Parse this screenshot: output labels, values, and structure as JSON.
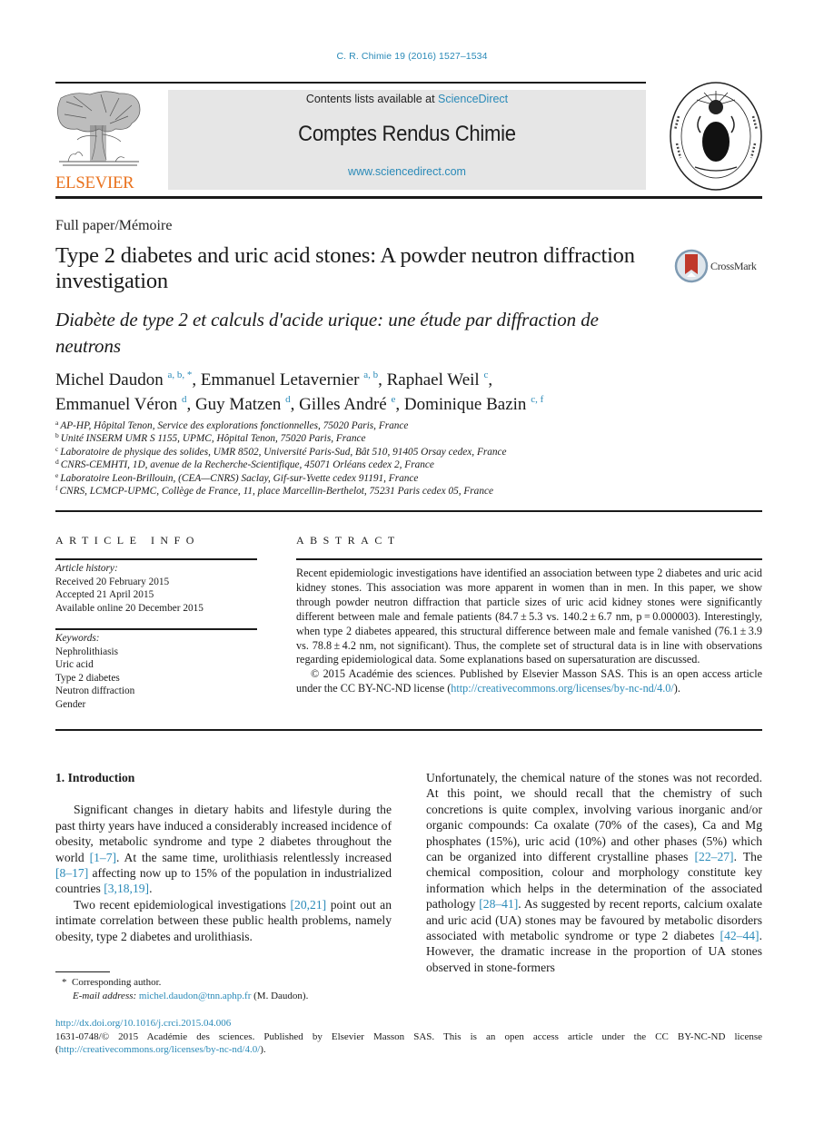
{
  "journal_ref": "C. R. Chimie 19 (2016) 1527–1534",
  "masthead": {
    "contents_prefix": "Contents lists available at ",
    "contents_link": "ScienceDirect",
    "journal_title": "Comptes Rendus Chimie",
    "url": "www.sciencedirect.com"
  },
  "publisher_logo": {
    "icon": "elsevier-tree-icon",
    "wordmark": "ELSEVIER"
  },
  "seal": {
    "icon": "academie-des-sciences-seal-icon"
  },
  "crossmark": {
    "icon": "crossmark-icon",
    "label": "CrossMark"
  },
  "article": {
    "type": "Full paper/Mémoire",
    "title": "Type 2 diabetes and uric acid stones: A powder neutron diffraction investigation",
    "french_title": "Diabète de type 2 et calculs d'acide urique: une étude par diffraction de neutrons"
  },
  "authors": [
    {
      "name": "Michel Daudon",
      "affil": "a, b, *",
      "sep": ", "
    },
    {
      "name": "Emmanuel Letavernier",
      "affil": "a, b",
      "sep": ", "
    },
    {
      "name": "Raphael Weil",
      "affil": "c",
      "sep": ","
    },
    {
      "name": "Emmanuel Véron",
      "affil": "d",
      "sep": ", "
    },
    {
      "name": "Guy Matzen",
      "affil": "d",
      "sep": ", "
    },
    {
      "name": "Gilles André",
      "affil": "e",
      "sep": ", "
    },
    {
      "name": "Dominique Bazin",
      "affil": "c, f",
      "sep": ""
    }
  ],
  "affiliations": [
    {
      "key": "a",
      "text": "AP-HP, Hôpital Tenon, Service des explorations fonctionnelles, 75020 Paris, France"
    },
    {
      "key": "b",
      "text": "Unité INSERM UMR S 1155, UPMC, Hôpital Tenon, 75020 Paris, France"
    },
    {
      "key": "c",
      "text": "Laboratoire de physique des solides, UMR 8502, Université Paris-Sud, Bât 510, 91405 Orsay cedex, France"
    },
    {
      "key": "d",
      "text": "CNRS-CEMHTI, 1D, avenue de la Recherche-Scientifique, 45071 Orléans cedex 2, France"
    },
    {
      "key": "e",
      "text": "Laboratoire Leon-Brillouin, (CEA—CNRS) Saclay, Gif-sur-Yvette cedex 91191, France"
    },
    {
      "key": "f",
      "text": "CNRS, LCMCP-UPMC, Collège de France, 11, place Marcellin-Berthelot, 75231 Paris cedex 05, France"
    }
  ],
  "article_info": {
    "label": "ARTICLE INFO",
    "history_heading": "Article history:",
    "history": [
      "Received 20 February 2015",
      "Accepted 21 April 2015",
      "Available online 20 December 2015"
    ],
    "keywords_heading": "Keywords:",
    "keywords": [
      "Nephrolithiasis",
      "Uric acid",
      "Type 2 diabetes",
      "Neutron diffraction",
      "Gender"
    ]
  },
  "abstract": {
    "label": "ABSTRACT",
    "text": "Recent epidemiologic investigations have identified an association between type 2 diabetes and uric acid kidney stones. This association was more apparent in women than in men. In this paper, we show through powder neutron diffraction that particle sizes of uric acid kidney stones were significantly different between male and female patients (84.7 ± 5.3 vs. 140.2 ± 6.7 nm, p = 0.000003). Interestingly, when type 2 diabetes appeared, this structural difference between male and female vanished (76.1 ± 3.9 vs. 78.8 ± 4.2 nm, not significant). Thus, the complete set of structural data is in line with observations regarding epidemiological data. Some explanations based on supersaturation are discussed.",
    "copyright_prefix": "© 2015 Académie des sciences. Published by Elsevier Masson SAS. This is an open access article under the CC BY-NC-ND license (",
    "license_link": "http://creativecommons.org/licenses/by-nc-nd/4.0/",
    "copyright_suffix": ")."
  },
  "body": {
    "section_heading": "1.  Introduction",
    "left_paragraphs": [
      [
        {
          "t": "Significant changes in dietary habits and lifestyle during the past thirty years have induced a considerably increased incidence of obesity, metabolic syndrome and type 2 diabetes throughout the world "
        },
        {
          "ref": "[1–7]"
        },
        {
          "t": ". At the same time, urolithiasis relentlessly increased "
        },
        {
          "ref": "[8–17]"
        },
        {
          "t": " affecting now up to 15% of the population in industrialized countries "
        },
        {
          "ref": "[3,18,19]"
        },
        {
          "t": "."
        }
      ],
      [
        {
          "t": "Two recent epidemiological investigations "
        },
        {
          "ref": "[20,21]"
        },
        {
          "t": " point out an intimate correlation between these public health problems, namely obesity, type 2 diabetes and urolithiasis."
        }
      ]
    ],
    "right_paragraphs": [
      [
        {
          "t": "Unfortunately, the chemical nature of the stones was not recorded. At this point, we should recall that the chemistry of such concretions is quite complex, involving various inorganic and/or organic compounds: Ca oxalate (70% of the cases), Ca and Mg phosphates (15%), uric acid (10%) and other phases (5%) which can be organized into different crystalline phases "
        },
        {
          "ref": "[22–27]"
        },
        {
          "t": ". The chemical composition, colour and morphology constitute key information which helps in the determination of the associated pathology "
        },
        {
          "ref": "[28–41]"
        },
        {
          "t": ". As suggested by recent reports, calcium oxalate and uric acid (UA) stones may be favoured by metabolic disorders associated with metabolic syndrome or type 2 diabetes "
        },
        {
          "ref": "[42–44]"
        },
        {
          "t": ". However, the dramatic increase in the proportion of UA stones observed in stone-formers"
        }
      ]
    ]
  },
  "footnote": {
    "star": "*",
    "corresponding": "Corresponding author.",
    "email_label": "E-mail address:",
    "email": "michel.daudon@tnn.aphp.fr",
    "email_suffix": " (M. Daudon)."
  },
  "footer": {
    "doi": "http://dx.doi.org/10.1016/j.crci.2015.04.006",
    "issn_copyright": "1631-0748/© 2015 Académie des sciences. Published by Elsevier Masson SAS. This is an open access article under the CC BY-NC-ND license (",
    "license_link": "http://creativecommons.org/licenses/by-nc-nd/4.0/",
    "suffix": ")."
  },
  "colors": {
    "link": "#2a8ab8",
    "elsevier_orange": "#e9711c",
    "masthead_bg": "#e6e6e6",
    "crossmark_red": "#c0392b"
  }
}
